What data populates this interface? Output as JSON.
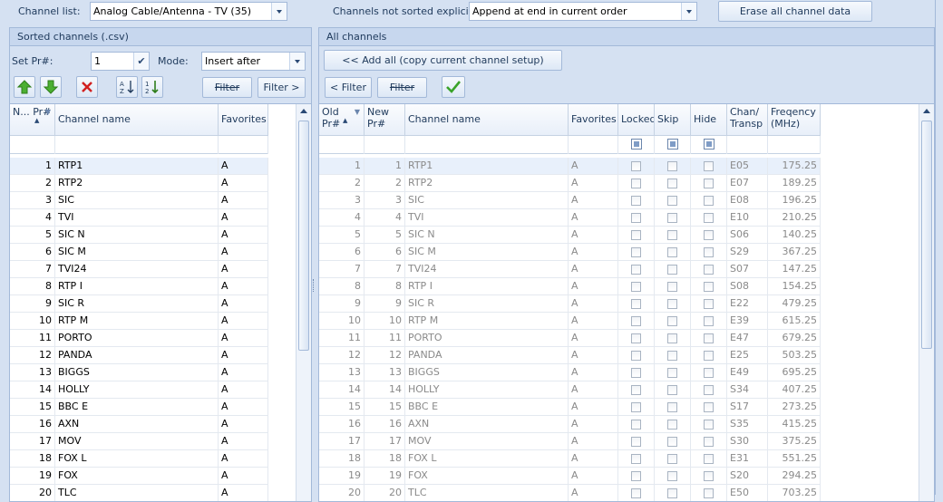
{
  "top": {
    "channel_list_label": "Channel list:",
    "channel_list_value": "Analog Cable/Antenna - TV (35)",
    "not_sorted_label": "Channels not sorted explicitly:",
    "not_sorted_value": "Append at end in current order",
    "erase_button": "Erase all channel data"
  },
  "left": {
    "title": "Sorted channels (.csv)",
    "set_pr_label": "Set Pr#:",
    "set_pr_value": "1",
    "mode_label": "Mode:",
    "mode_value": "Insert after",
    "filter_button": "Filter",
    "filter_next_button": "Filter >",
    "columns": [
      "N... Pr#",
      "Channel name",
      "Favorites"
    ],
    "rows": [
      [
        "1",
        "RTP1",
        "A"
      ],
      [
        "2",
        "RTP2",
        "A"
      ],
      [
        "3",
        "SIC",
        "A"
      ],
      [
        "4",
        "TVI",
        "A"
      ],
      [
        "5",
        "SIC N",
        "A"
      ],
      [
        "6",
        "SIC M",
        "A"
      ],
      [
        "7",
        "TVI24",
        "A"
      ],
      [
        "8",
        "RTP I",
        "A"
      ],
      [
        "9",
        "SIC R",
        "A"
      ],
      [
        "10",
        "RTP M",
        "A"
      ],
      [
        "11",
        "PORTO",
        "A"
      ],
      [
        "12",
        "PANDA",
        "A"
      ],
      [
        "13",
        "BIGGS",
        "A"
      ],
      [
        "14",
        "HOLLY",
        "A"
      ],
      [
        "15",
        "BBC E",
        "A"
      ],
      [
        "16",
        "AXN",
        "A"
      ],
      [
        "17",
        "MOV",
        "A"
      ],
      [
        "18",
        "FOX L",
        "A"
      ],
      [
        "19",
        "FOX",
        "A"
      ],
      [
        "20",
        "TLC",
        "A"
      ]
    ]
  },
  "right": {
    "title": "All channels",
    "add_all_button": "<< Add all (copy current channel setup)",
    "filter_prev_button": "< Filter",
    "filter_button": "Filter",
    "columns": [
      "Old Pr#",
      "New Pr#",
      "Channel name",
      "Favorites",
      "Locked",
      "Skip",
      "Hide",
      "Chan/ Transp",
      "Freqency (MHz)"
    ],
    "rows": [
      [
        "1",
        "1",
        "RTP1",
        "A",
        "E05",
        "175.25"
      ],
      [
        "2",
        "2",
        "RTP2",
        "A",
        "E07",
        "189.25"
      ],
      [
        "3",
        "3",
        "SIC",
        "A",
        "E08",
        "196.25"
      ],
      [
        "4",
        "4",
        "TVI",
        "A",
        "E10",
        "210.25"
      ],
      [
        "5",
        "5",
        "SIC N",
        "A",
        "S06",
        "140.25"
      ],
      [
        "6",
        "6",
        "SIC M",
        "A",
        "S29",
        "367.25"
      ],
      [
        "7",
        "7",
        "TVI24",
        "A",
        "S07",
        "147.25"
      ],
      [
        "8",
        "8",
        "RTP I",
        "A",
        "S08",
        "154.25"
      ],
      [
        "9",
        "9",
        "SIC R",
        "A",
        "E22",
        "479.25"
      ],
      [
        "10",
        "10",
        "RTP M",
        "A",
        "E39",
        "615.25"
      ],
      [
        "11",
        "11",
        "PORTO",
        "A",
        "E47",
        "679.25"
      ],
      [
        "12",
        "12",
        "PANDA",
        "A",
        "E25",
        "503.25"
      ],
      [
        "13",
        "13",
        "BIGGS",
        "A",
        "E49",
        "695.25"
      ],
      [
        "14",
        "14",
        "HOLLY",
        "A",
        "S34",
        "407.25"
      ],
      [
        "15",
        "15",
        "BBC E",
        "A",
        "S17",
        "273.25"
      ],
      [
        "16",
        "16",
        "AXN",
        "A",
        "S35",
        "415.25"
      ],
      [
        "17",
        "17",
        "MOV",
        "A",
        "S30",
        "375.25"
      ],
      [
        "18",
        "18",
        "FOX L",
        "A",
        "E31",
        "551.25"
      ],
      [
        "19",
        "19",
        "FOX",
        "A",
        "S20",
        "294.25"
      ],
      [
        "20",
        "20",
        "TLC",
        "A",
        "E50",
        "703.25"
      ]
    ]
  }
}
